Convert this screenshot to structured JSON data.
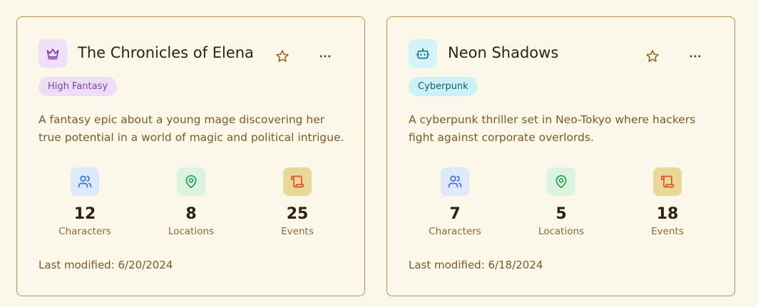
{
  "projects": [
    {
      "title": "The Chronicles of Elena",
      "icon": "crown-icon",
      "icon_bg": "#efe0f8",
      "icon_color": "#7b3fb0",
      "tag": "High Fantasy",
      "tag_bg": "#efdcf5",
      "tag_color": "#7b3fb0",
      "description": "A fantasy epic about a young mage discovering her true potential in a world of magic and political intrigue.",
      "stats": {
        "characters": {
          "value": "12",
          "label": "Characters"
        },
        "locations": {
          "value": "8",
          "label": "Locations"
        },
        "events": {
          "value": "25",
          "label": "Events"
        }
      },
      "last_modified": "Last modified: 6/20/2024"
    },
    {
      "title": "Neon Shadows",
      "icon": "robot-icon",
      "icon_bg": "#d3f3f8",
      "icon_color": "#0e7490",
      "tag": "Cyberpunk",
      "tag_bg": "#cdf1f7",
      "tag_color": "#0e6074",
      "description": "A cyberpunk thriller set in Neo-Tokyo where hackers fight against corporate overlords.",
      "stats": {
        "characters": {
          "value": "7",
          "label": "Characters"
        },
        "locations": {
          "value": "5",
          "label": "Locations"
        },
        "events": {
          "value": "18",
          "label": "Events"
        }
      },
      "last_modified": "Last modified: 6/18/2024"
    }
  ],
  "colors": {
    "characters_bg": "#dde8f8",
    "characters_fg": "#3b6fd0",
    "locations_bg": "#dcf3e1",
    "locations_fg": "#22a04f",
    "events_bg": "#ead79a",
    "events_fg": "#d9531e",
    "star": "#9a6a22",
    "border": "#b88f54"
  }
}
